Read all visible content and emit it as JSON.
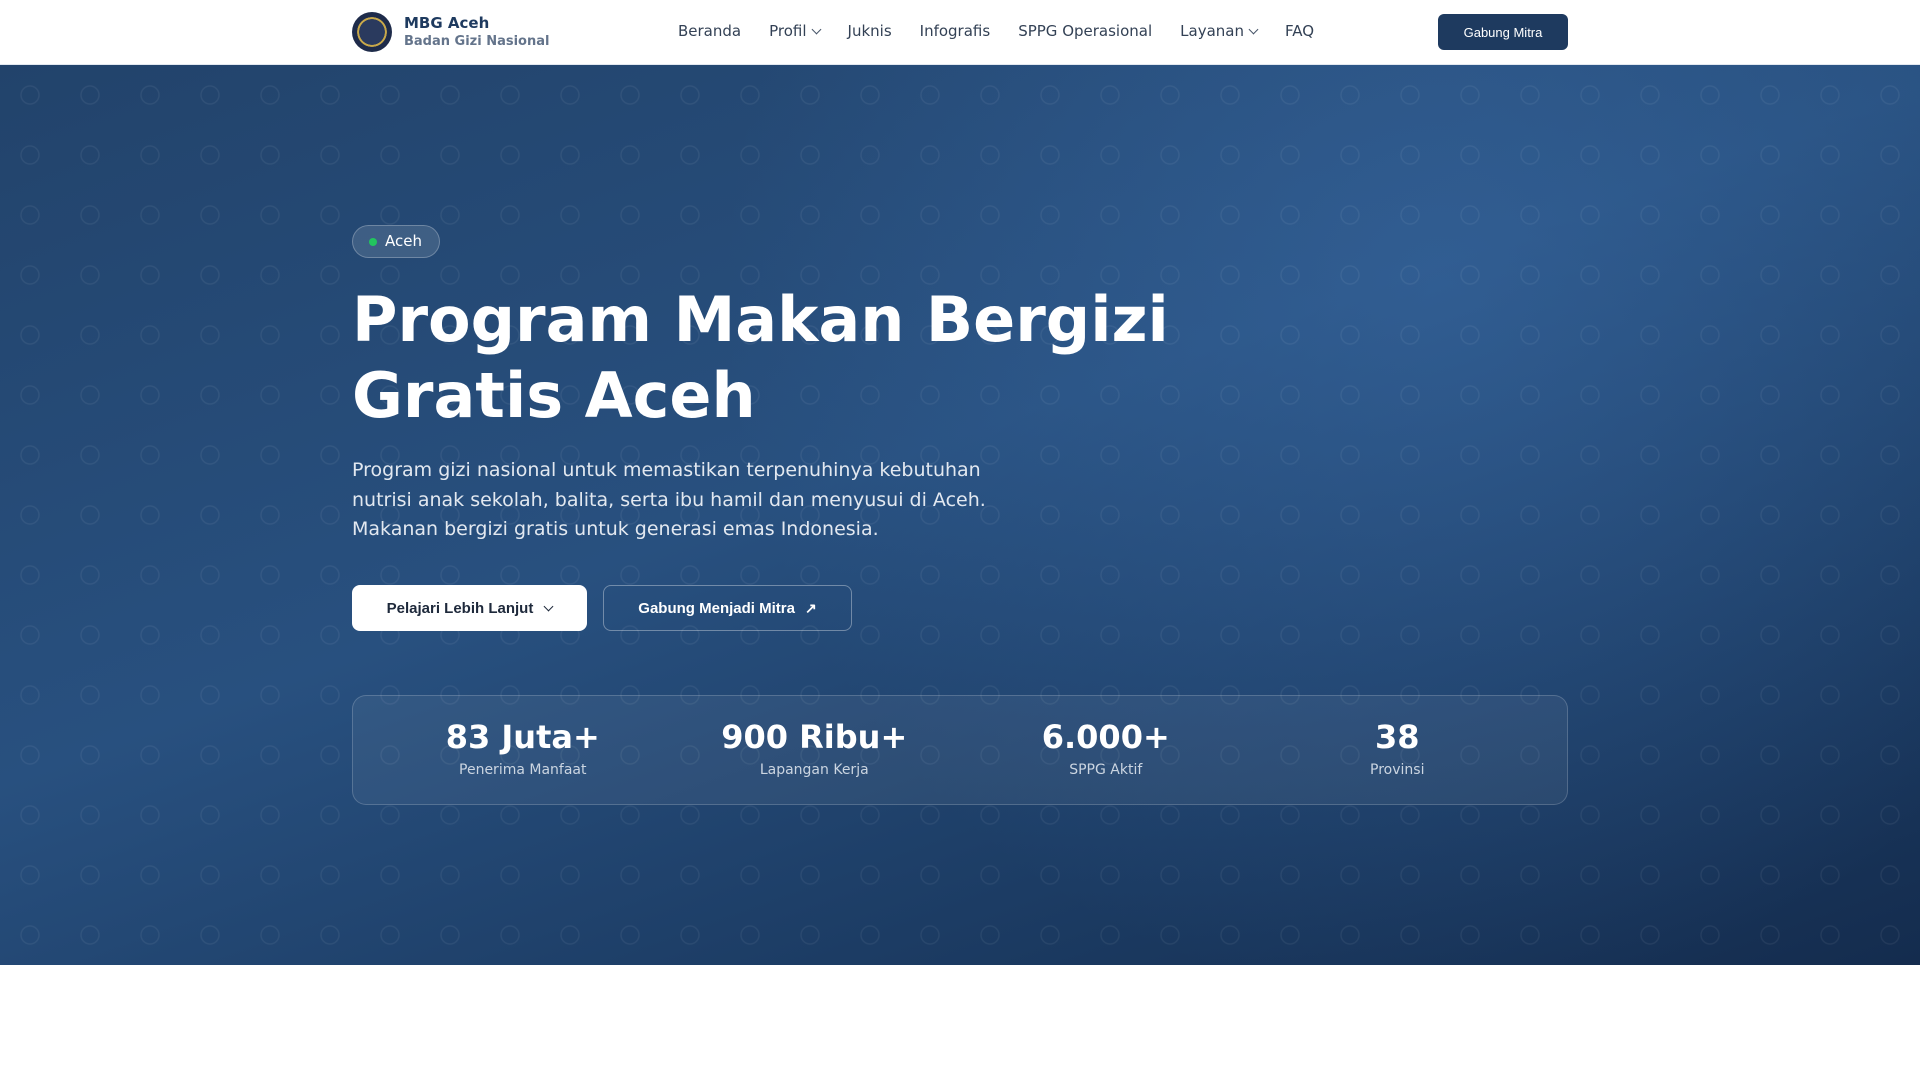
{
  "header": {
    "brand_title": "MBG Aceh",
    "brand_subtitle": "Badan Gizi Nasional",
    "nav": [
      {
        "label": "Beranda"
      },
      {
        "label": "Profil"
      },
      {
        "label": "Juknis"
      },
      {
        "label": "Infografis"
      },
      {
        "label": "SPPG Operasional"
      },
      {
        "label": "Layanan"
      },
      {
        "label": "FAQ"
      }
    ],
    "cta": "Gabung Mitra"
  },
  "hero": {
    "badge": "Aceh",
    "title": "Program Makan Bergizi Gratis Aceh",
    "description": "Program gizi nasional untuk memastikan terpenuhinya kebutuhan nutrisi anak sekolah, balita, serta ibu hamil dan menyusui di Aceh. Makanan bergizi gratis untuk generasi emas Indonesia.",
    "primary_button": "Pelajari Lebih Lanjut",
    "secondary_button": "Gabung Menjadi Mitra"
  },
  "stats": [
    {
      "value": "83 Juta+",
      "label": "Penerima Manfaat"
    },
    {
      "value": "900 Ribu+",
      "label": "Lapangan Kerja"
    },
    {
      "value": "6.000+",
      "label": "SPPG Aktif"
    },
    {
      "value": "38",
      "label": "Provinsi"
    }
  ],
  "colors": {
    "primary": "#1e3a5f",
    "badge_dot": "#22c55e"
  }
}
